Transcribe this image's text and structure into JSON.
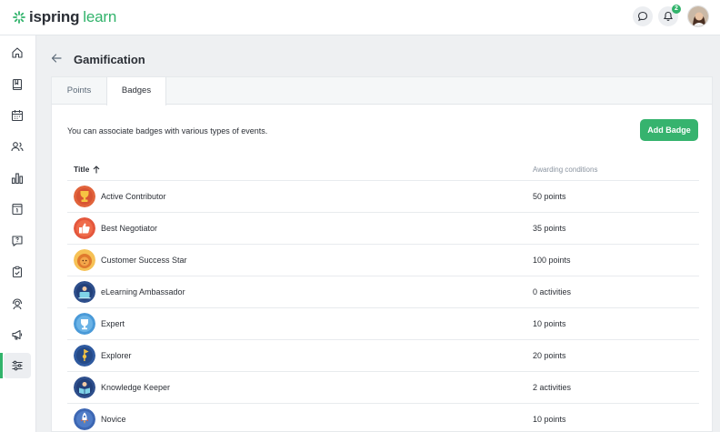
{
  "app": {
    "logo_part1": "ispring",
    "logo_part2": "learn",
    "notification_count": "2",
    "brand_color": "#31b36b"
  },
  "sidebar": {
    "items": [
      {
        "icon": "home-icon"
      },
      {
        "icon": "book-icon"
      },
      {
        "icon": "calendar-icon"
      },
      {
        "icon": "users-icon"
      },
      {
        "icon": "bar-chart-icon"
      },
      {
        "icon": "info-board-icon"
      },
      {
        "icon": "question-chat-icon"
      },
      {
        "icon": "clipboard-check-icon"
      },
      {
        "icon": "support-person-icon"
      },
      {
        "icon": "megaphone-icon"
      },
      {
        "icon": "sliders-icon",
        "active": true
      }
    ]
  },
  "page": {
    "title": "Gamification",
    "tabs": [
      {
        "label": "Points"
      },
      {
        "label": "Badges",
        "active": true
      }
    ],
    "description": "You can associate badges with various types of events.",
    "add_button": "Add Badge"
  },
  "table": {
    "col_title": "Title",
    "col_conditions": "Awarding conditions",
    "rows": [
      {
        "name": "Active Contributor",
        "condition": "50 points",
        "icon": "trophy-badge-icon",
        "color": "#e1643c"
      },
      {
        "name": "Best Negotiator",
        "condition": "35 points",
        "icon": "thumbs-up-badge-icon",
        "color": "#e4573d"
      },
      {
        "name": "Customer Success Star",
        "condition": "100 points",
        "icon": "lion-badge-icon",
        "color": "#f0a84a"
      },
      {
        "name": "eLearning Ambassador",
        "condition": "0 activities",
        "icon": "laptop-badge-icon",
        "color": "#2e4f8c"
      },
      {
        "name": "Expert",
        "condition": "10 points",
        "icon": "cup-badge-icon",
        "color": "#4a9ad8"
      },
      {
        "name": "Explorer",
        "condition": "20 points",
        "icon": "flag-badge-icon",
        "color": "#2f5aa0"
      },
      {
        "name": "Knowledge Keeper",
        "condition": "2 activities",
        "icon": "book-badge-icon",
        "color": "#2e4f8c"
      },
      {
        "name": "Novice",
        "condition": "10 points",
        "icon": "rocket-badge-icon",
        "color": "#3d67b3"
      }
    ]
  }
}
